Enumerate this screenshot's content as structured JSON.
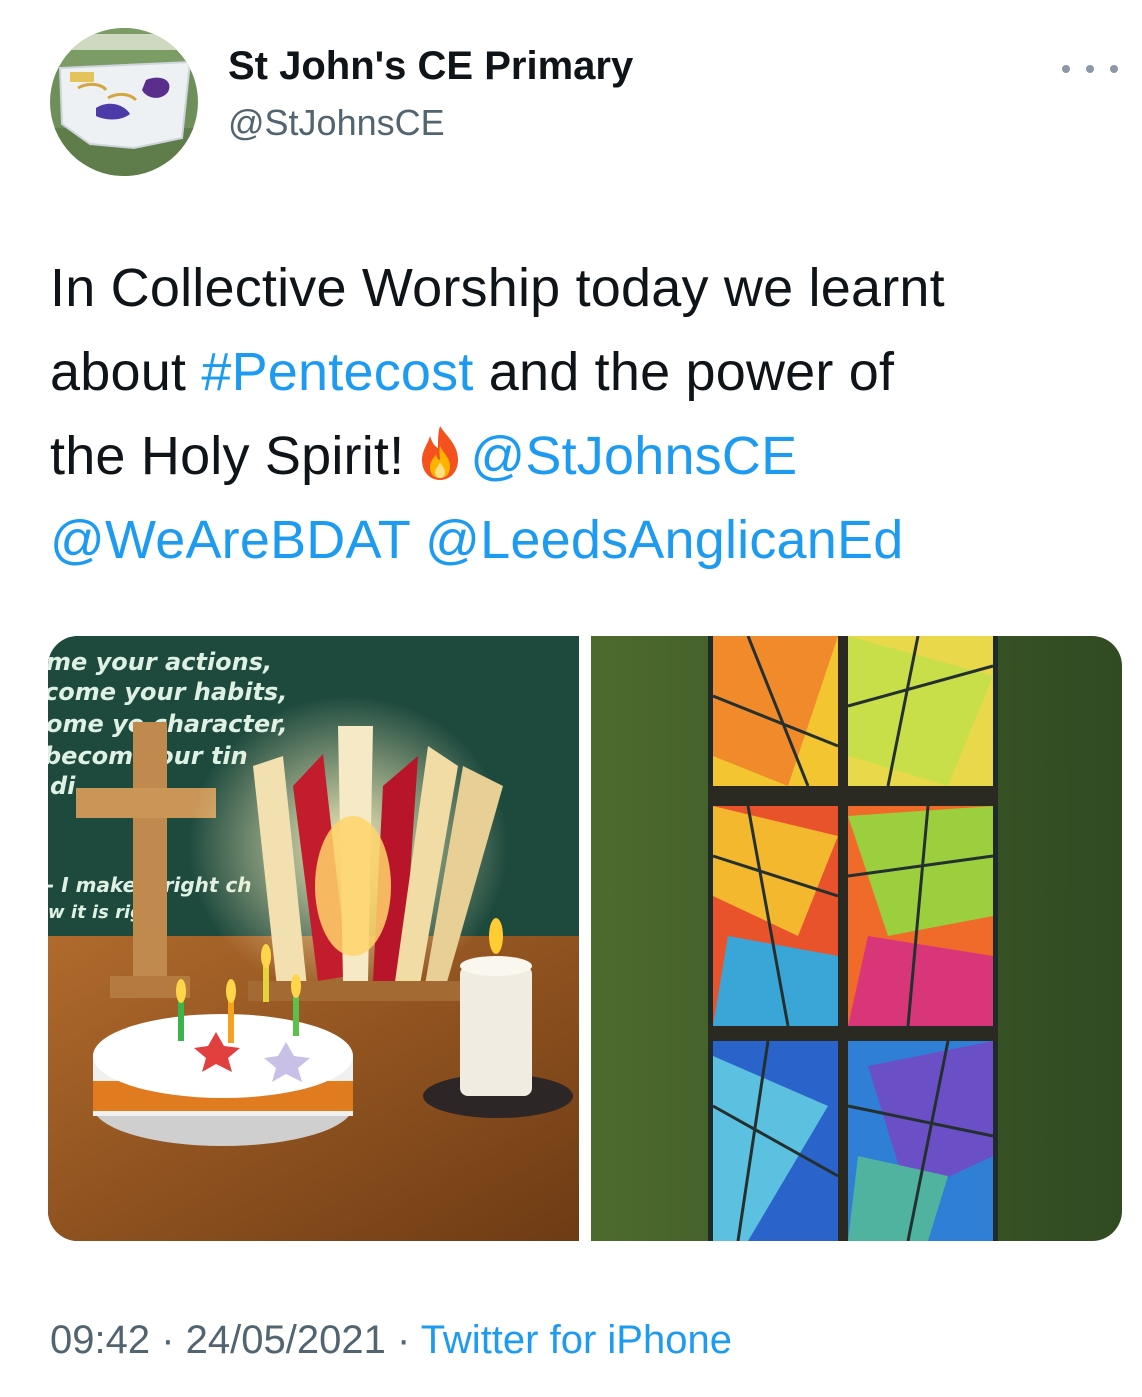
{
  "account": {
    "display_name": "St John's CE Primary",
    "handle": "@StJohnsCE",
    "avatar_icon": "school-banner-avatar"
  },
  "more_icon": "more-options-icon",
  "tweet": {
    "line1": "In Collective Worship today we learnt",
    "text_about": "about ",
    "hashtag": "#Pentecost",
    "text_power": " and the power of",
    "text_holy": "the Holy Spirit!",
    "emoji": "fire-emoji",
    "mention1": "@StJohnsCE",
    "mention2": "@WeAreBDAT",
    "mention3": "@LeedsAnglicanEd"
  },
  "media": {
    "left_photo": {
      "sign_lines": [
        "me your actions,",
        "come your habits,",
        "ome yo   character,",
        "becom   your    tin",
        "di"
      ],
      "sign_lower": [
        "- I make    e right ch",
        "w it is righ"
      ]
    },
    "right_photo": {
      "description_icon": "stained-glass-window"
    }
  },
  "footer": {
    "time": "09:42",
    "separator": " · ",
    "date": "24/05/2021",
    "source": "Twitter for iPhone"
  },
  "colors": {
    "link": "#1d9bf0",
    "text": "#0f1419",
    "secondary": "#536471"
  }
}
